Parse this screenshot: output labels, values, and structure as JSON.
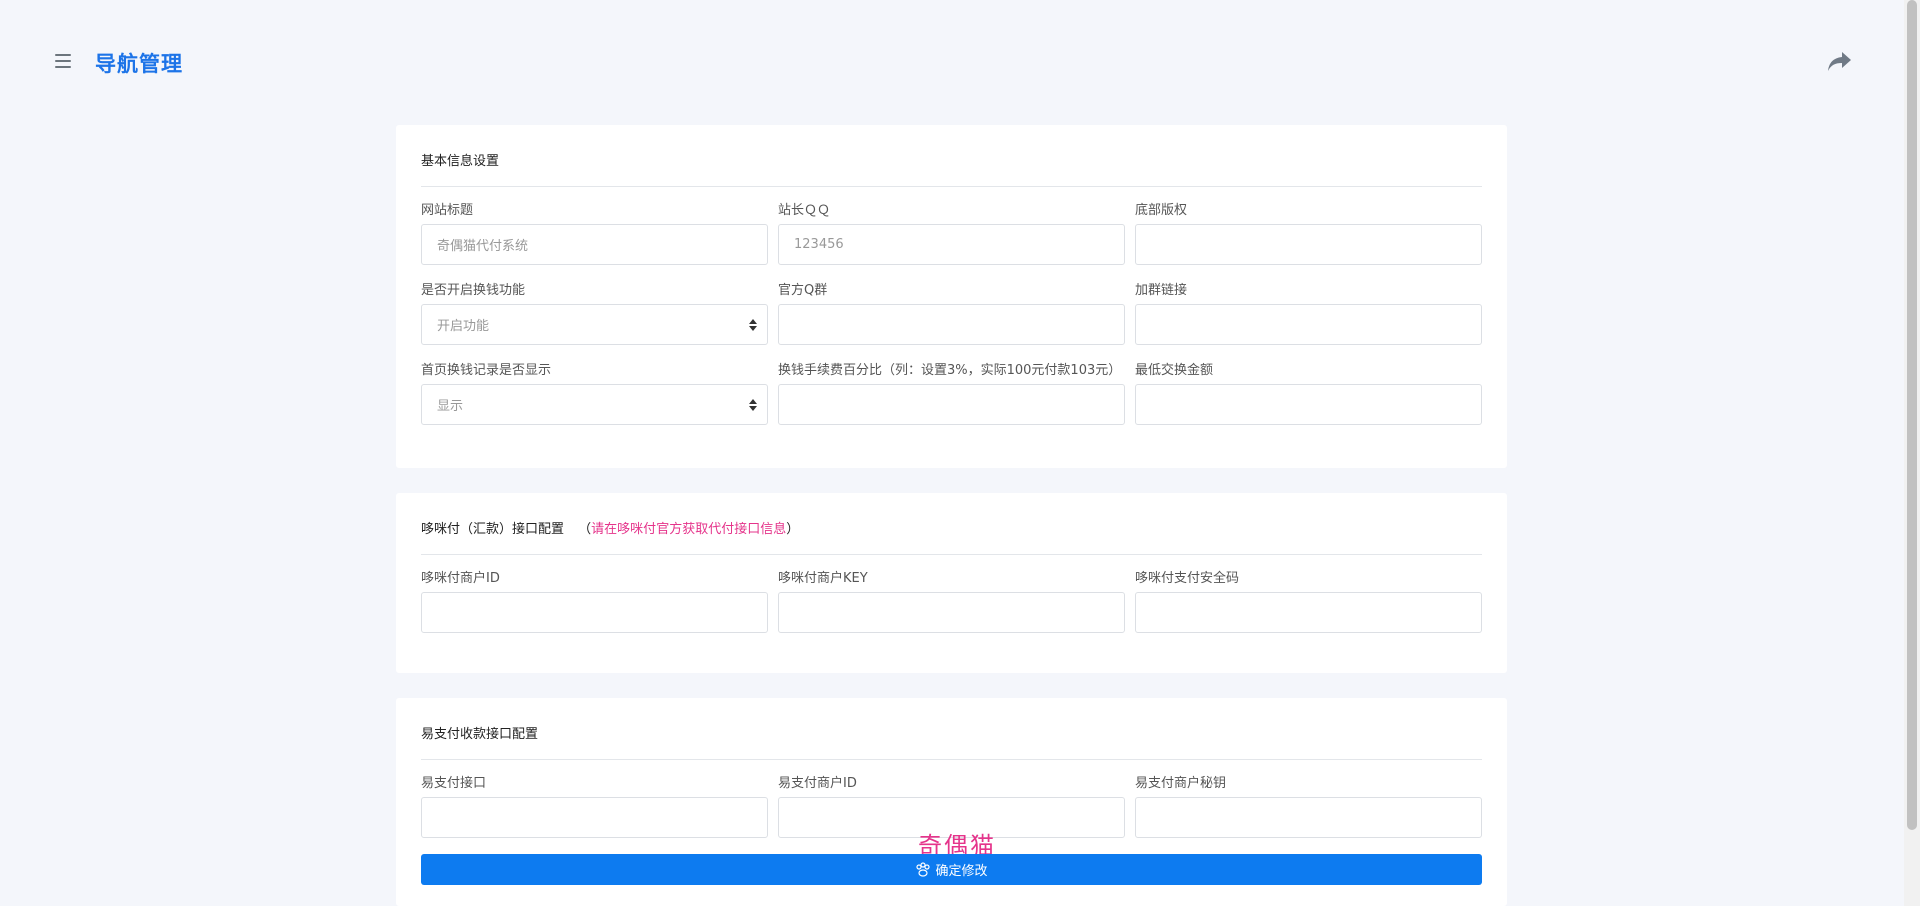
{
  "header": {
    "title": "导航管理"
  },
  "basic": {
    "title": "基本信息设置",
    "fields": [
      {
        "label": "网站标题",
        "value": "奇偶猫代付系统"
      },
      {
        "label": "站长ＱＱ",
        "value": "123456"
      },
      {
        "label": "底部版权",
        "value": ""
      },
      {
        "label": "是否开启换钱功能",
        "value": "开启功能"
      },
      {
        "label": "官方Q群",
        "value": ""
      },
      {
        "label": "加群链接",
        "value": ""
      },
      {
        "label": "首页换钱记录是否显示",
        "value": "显示"
      },
      {
        "label": "换钱手续费百分比（列：设置3%，实际100元付款103元）",
        "value": ""
      },
      {
        "label": "最低交换金额",
        "value": ""
      }
    ]
  },
  "mipay": {
    "title": "哆咪付（汇款）接口配置",
    "hint_open": "（",
    "hint_blue": "请在哆咪付",
    "hint_pink": "官方获取代付接口信息",
    "hint_close": "）",
    "fields": [
      {
        "label": "哆咪付商户ID",
        "value": ""
      },
      {
        "label": "哆咪付商户KEY",
        "value": ""
      },
      {
        "label": "哆咪付支付安全码",
        "value": ""
      }
    ]
  },
  "epay": {
    "title": "易支付收款接口配置",
    "fields": [
      {
        "label": "易支付接口",
        "value": ""
      },
      {
        "label": "易支付商户ID",
        "value": ""
      },
      {
        "label": "易支付商户秘钥",
        "value": ""
      }
    ]
  },
  "submit": {
    "label": "确定修改"
  },
  "watermark": "奇偶猫",
  "icons": {
    "menu": "menu-icon",
    "share": "share-icon",
    "select_arrows": "sort-arrows-icon",
    "submit": "paw-icon"
  },
  "colors": {
    "accent": "#1d74e8",
    "button": "#0d7bf0",
    "hint_pink": "#e5348b"
  }
}
